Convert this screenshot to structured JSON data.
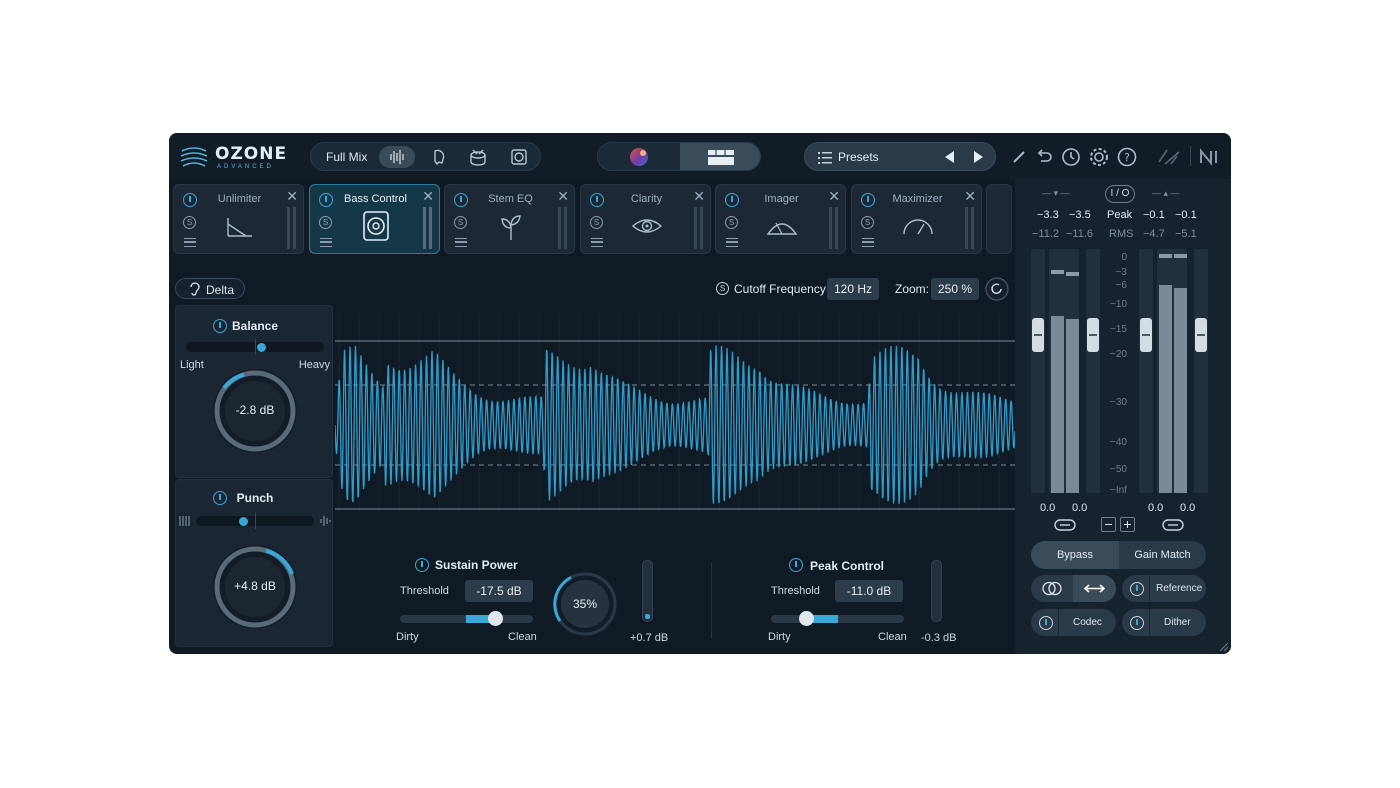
{
  "app": {
    "logo_text": "OZONE",
    "logo_sub": "ADVANCED"
  },
  "topbar": {
    "assistant_mode": "Full Mix",
    "presets_label": "Presets",
    "icons": [
      "waveform-icon",
      "vocal-icon",
      "drum-icon",
      "speaker-icon",
      "pen-icon",
      "undo-icon",
      "history-icon",
      "gear-icon",
      "help-icon",
      "ni-logo-icon"
    ]
  },
  "modules": [
    {
      "name": "Unlimiter",
      "active": false
    },
    {
      "name": "Bass Control",
      "active": true
    },
    {
      "name": "Stem EQ",
      "active": false
    },
    {
      "name": "Clarity",
      "active": false
    },
    {
      "name": "Imager",
      "active": false
    },
    {
      "name": "Maximizer",
      "active": false
    }
  ],
  "editor": {
    "delta_label": "Delta",
    "cutoff_label": "Cutoff Frequency:",
    "cutoff_value": "120 Hz",
    "zoom_label": "Zoom:",
    "zoom_value": "250 %"
  },
  "balance": {
    "title": "Balance",
    "left_label": "Light",
    "right_label": "Heavy",
    "value": "-2.8 dB",
    "slider_fraction": 0.55
  },
  "punch": {
    "title": "Punch",
    "value": "+4.8 dB",
    "slider_fraction": 0.4
  },
  "sustain": {
    "title": "Sustain Power",
    "threshold_label": "Threshold",
    "threshold_value": "-17.5 dB",
    "left_label": "Dirty",
    "right_label": "Clean",
    "amount": "35%",
    "gain": "+0.7 dB"
  },
  "peak": {
    "title": "Peak Control",
    "threshold_label": "Threshold",
    "threshold_value": "-11.0 dB",
    "left_label": "Dirty",
    "right_label": "Clean",
    "gain": "-0.3 dB"
  },
  "meters": {
    "io_label": "I / O",
    "peak_label": "Peak",
    "rms_label": "RMS",
    "in_peak": [
      "−3.3",
      "−3.5"
    ],
    "in_rms": [
      "−11.2",
      "−11.6"
    ],
    "out_peak": [
      "−0.1",
      "−0.1"
    ],
    "out_rms": [
      "−4.7",
      "−5.1"
    ],
    "scale": [
      "0",
      "−3",
      "−6",
      "−10",
      "−15",
      "−20",
      "−30",
      "−40",
      "−50",
      "−Inf"
    ],
    "in_gain": [
      "0.0",
      "0.0"
    ],
    "out_gain": [
      "0.0",
      "0.0"
    ],
    "bypass_label": "Bypass",
    "gain_match_label": "Gain Match",
    "reference_label": "Reference",
    "codec_label": "Codec",
    "dither_label": "Dither"
  },
  "colors": {
    "accent": "#3aa7d8",
    "background": "#101a24"
  }
}
